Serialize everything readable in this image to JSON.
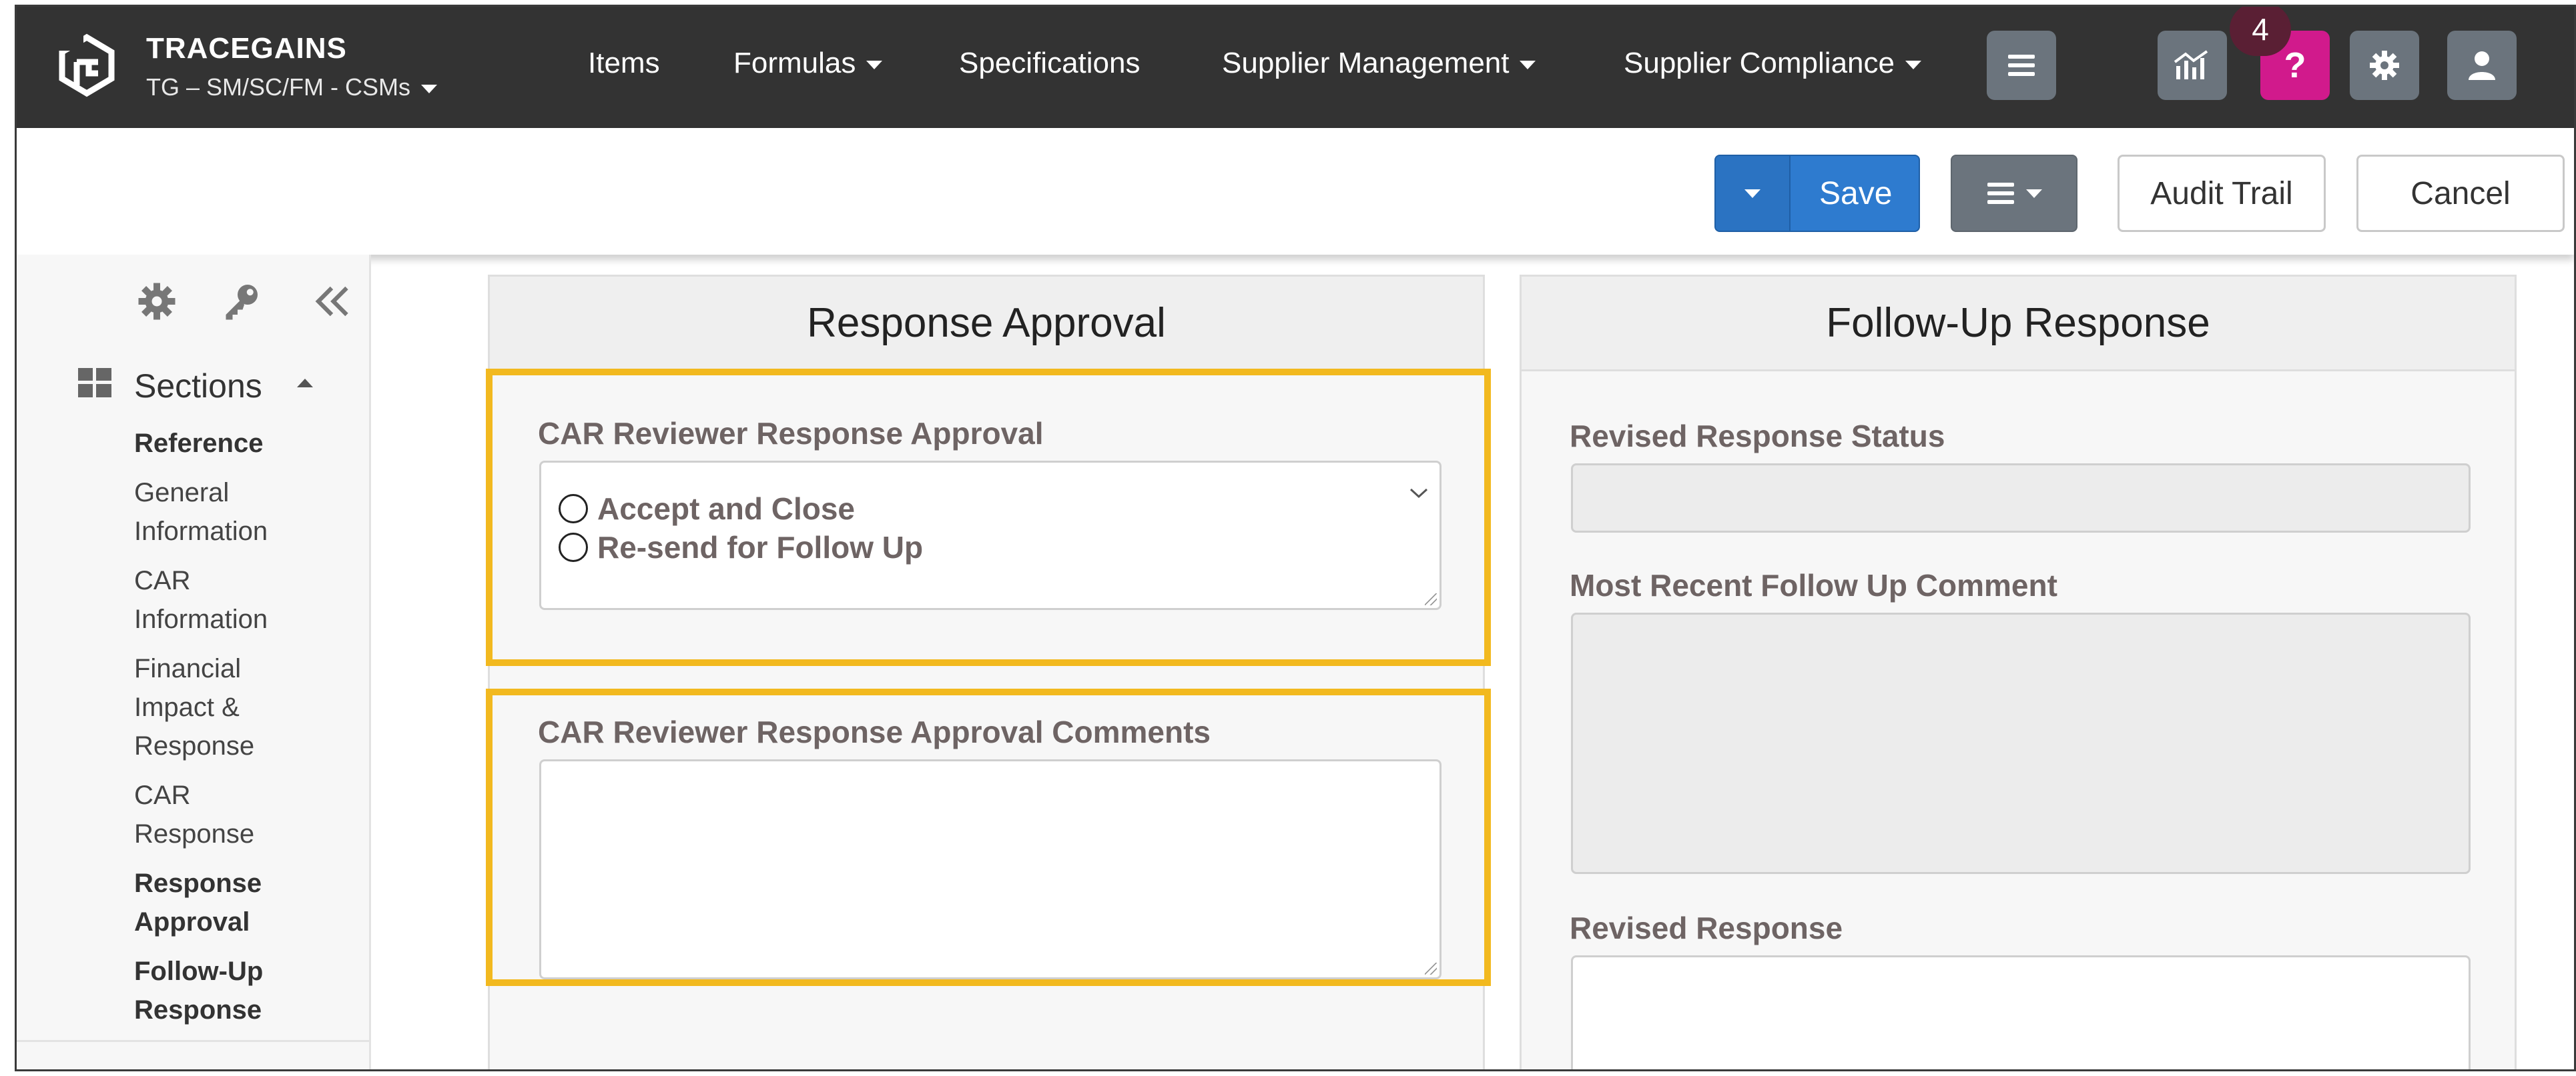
{
  "brand": {
    "name": "TRACEGAINS",
    "context": "TG – SM/SC/FM - CSMs"
  },
  "nav": {
    "items": [
      {
        "label": "Items",
        "has_dropdown": false
      },
      {
        "label": "Formulas",
        "has_dropdown": true
      },
      {
        "label": "Specifications",
        "has_dropdown": false
      },
      {
        "label": "Supplier Management",
        "has_dropdown": true
      },
      {
        "label": "Supplier Compliance",
        "has_dropdown": true
      }
    ],
    "notification_count": "4",
    "icons": [
      "hamburger-icon",
      "analytics-icon",
      "help-icon",
      "gear-icon",
      "user-icon"
    ],
    "help_color": "#d11a8c"
  },
  "actions": {
    "save": "Save",
    "audit_trail": "Audit Trail",
    "cancel": "Cancel"
  },
  "sidebar": {
    "sections_title": "Sections",
    "items": [
      {
        "label": "Reference",
        "bold": true
      },
      {
        "label": "General Information",
        "bold": false
      },
      {
        "label": "CAR Information",
        "bold": false
      },
      {
        "label": "Financial Impact & Response",
        "bold": false
      },
      {
        "label": "CAR Response",
        "bold": false
      },
      {
        "label": "Response Approval",
        "bold": true
      },
      {
        "label": "Follow-Up Response",
        "bold": true
      }
    ]
  },
  "response_approval": {
    "title": "Response Approval",
    "approval_label": "CAR Reviewer Response Approval",
    "options": [
      "Accept and Close",
      "Re-send for Follow Up"
    ],
    "comments_label": "CAR Reviewer Response Approval Comments",
    "comments_value": ""
  },
  "follow_up": {
    "title": "Follow-Up Response",
    "status_label": "Revised Response Status",
    "status_value": "",
    "comment_label": "Most Recent Follow Up Comment",
    "comment_value": "",
    "revised_label": "Revised Response",
    "revised_value": ""
  },
  "colors": {
    "navbar": "#333333",
    "primary": "#2e7bcf",
    "highlight": "#f2b91f"
  }
}
